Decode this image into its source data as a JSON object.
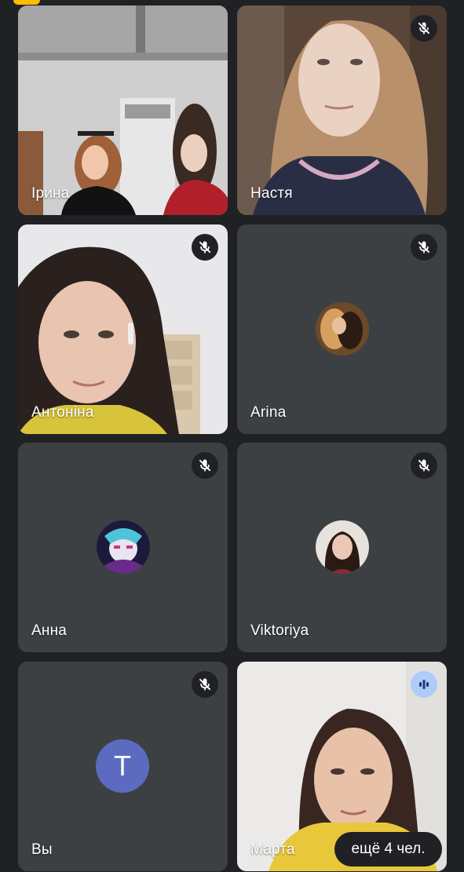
{
  "participants": [
    {
      "name": "Ірина",
      "status": "video"
    },
    {
      "name": "Настя",
      "status": "video-muted"
    },
    {
      "name": "Антоніна",
      "status": "video-muted"
    },
    {
      "name": "Arina",
      "status": "avatar-muted"
    },
    {
      "name": "Анна",
      "status": "avatar-muted"
    },
    {
      "name": "Viktoriya",
      "status": "avatar-muted"
    },
    {
      "name": "Вы",
      "status": "avatar-muted",
      "avatar_letter": "T"
    },
    {
      "name": "Марта",
      "status": "video-speaking"
    }
  ],
  "overflow": {
    "label": "ещё 4 чел."
  },
  "colors": {
    "background": "#202124",
    "tile": "#3c4043",
    "self_avatar": "#5c6bc0",
    "speaking_badge": "#aecbfa",
    "top_indicator": "#fbbc04"
  },
  "icons": {
    "muted": "mic-off-icon",
    "speaking": "audio-level-icon"
  }
}
